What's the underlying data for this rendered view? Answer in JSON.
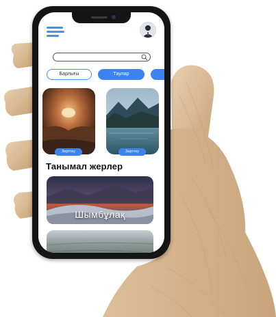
{
  "tabs": {
    "all_label": "Барлығы",
    "mountains_label": "Таулар"
  },
  "cards": [
    {
      "button_label": "Зерттеу",
      "image": "cave-photo"
    },
    {
      "button_label": "Зерттеу",
      "image": "mountain-lake-photo"
    }
  ],
  "popular": {
    "title": "Танымал жерлер",
    "items": [
      {
        "label": "Шымбұлақ",
        "image": "snowy-mountains-sunset-photo"
      },
      {
        "image": "aerial-landscape-photo"
      }
    ]
  },
  "colors": {
    "accent": "#3c83ef",
    "menu": "#4d8fe6",
    "text": "#111111"
  },
  "icons": [
    "menu-icon",
    "search-icon",
    "avatar",
    "wooden-hand"
  ]
}
